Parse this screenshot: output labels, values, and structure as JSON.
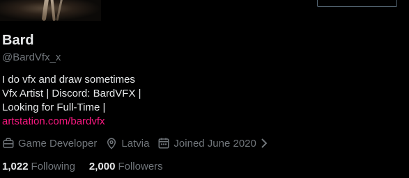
{
  "profile": {
    "name": "Bard",
    "handle": "@BardVfx_x",
    "bio_lines": [
      "I do vfx and draw sometimes",
      "Vfx Artist | Discord: BardVFX |",
      "Looking for Full-Time |"
    ],
    "link": "artstation.com/bardvfx",
    "link_color": "#f91880",
    "meta": {
      "profession": "Game Developer",
      "location": "Latvia",
      "joined": "Joined June 2020"
    },
    "following_count": "1,022",
    "following_label": "Following",
    "followers_count": "2,000",
    "followers_label": "Followers"
  },
  "icons": {
    "profession": "briefcase-icon",
    "location": "location-pin-icon",
    "joined": "calendar-icon",
    "expand": "chevron-right-icon"
  }
}
